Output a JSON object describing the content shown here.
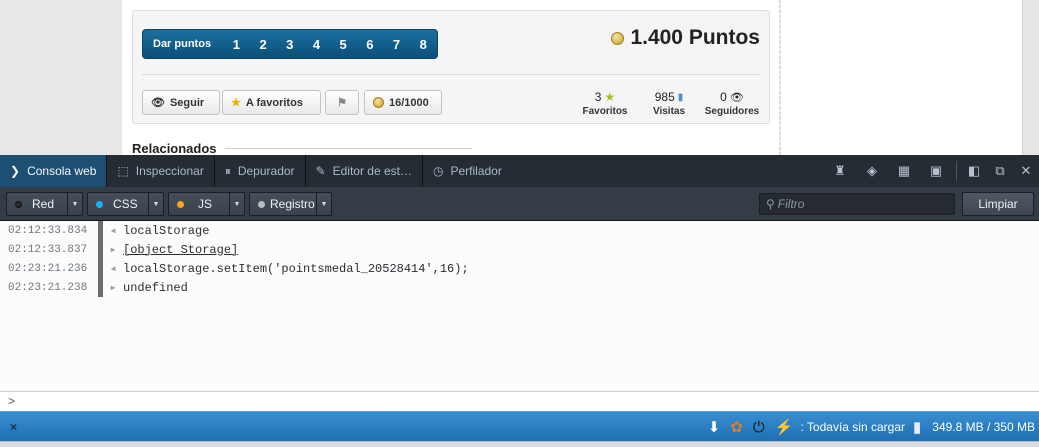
{
  "page": {
    "points_label": "Dar puntos",
    "points_options": [
      "1",
      "2",
      "3",
      "4",
      "5",
      "6",
      "7",
      "8"
    ],
    "total_points": "1.400 Puntos",
    "buttons": {
      "follow": "Seguir",
      "favorite": "A favoritos",
      "counter": "16/1000"
    },
    "stats": [
      {
        "value": "3",
        "label": "Favoritos",
        "icon": "star-icon"
      },
      {
        "value": "985",
        "label": "Visitas",
        "icon": "bar-chart-icon"
      },
      {
        "value": "0",
        "label": "Seguidores",
        "icon": "eye-icon"
      }
    ],
    "related_heading": "Relacionados"
  },
  "devtools": {
    "tabs": [
      {
        "label": "Consola web",
        "icon": "console-icon",
        "active": true
      },
      {
        "label": "Inspeccionar",
        "icon": "inspector-icon"
      },
      {
        "label": "Depurador",
        "icon": "debugger-icon"
      },
      {
        "label": "Editor de est…",
        "icon": "style-editor-icon"
      },
      {
        "label": "Perfilador",
        "icon": "profiler-icon"
      }
    ],
    "filters": {
      "net": "Red",
      "css": "CSS",
      "js": "JS",
      "log": "Registro"
    },
    "filter_colors": {
      "net": "#2b2b2b",
      "css": "#1ab0f0",
      "js": "#f7a41d",
      "log": "#b8bcc0"
    },
    "filter_placeholder": "Filtro",
    "clear_label": "Limpiar",
    "console_rows": [
      {
        "time": "02:12:33.834",
        "text": "localStorage",
        "dir": "in"
      },
      {
        "time": "02:12:33.837",
        "text": "[object Storage]",
        "dir": "out"
      },
      {
        "time": "02:23:21.236",
        "text": "localStorage.setItem('pointsmedal_20528414',16);",
        "dir": "in"
      },
      {
        "time": "02:23:21.238",
        "text": "undefined",
        "dir": "out"
      }
    ],
    "prompt": ">"
  },
  "statusbar": {
    "close": "×",
    "load_status": ": Todavía sin cargar",
    "memory": "349.8 MB / 350 MB"
  }
}
